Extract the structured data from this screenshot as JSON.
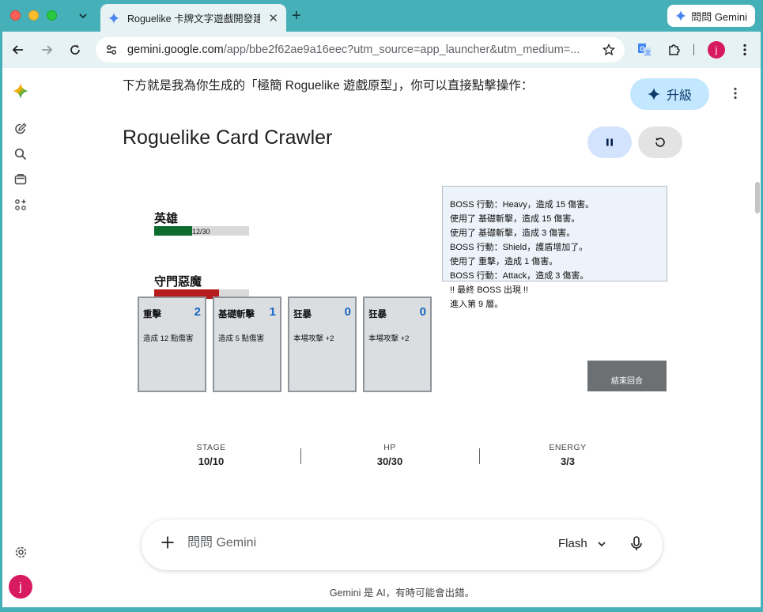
{
  "browser": {
    "tab_title": "Roguelike 卡牌文字遊戲開發建",
    "ask_gemini": "問問 Gemini",
    "url_host": "gemini.google.com",
    "url_path": "/app/bbe2f62ae9a16eec?utm_source=app_launcher&utm_medium=...",
    "profile_initial": "j"
  },
  "sidebar": {
    "avatar_initial": "j"
  },
  "header": {
    "upgrade_label": "升級"
  },
  "chat": {
    "intro": "下方就是我為你生成的「極簡 Roguelike 遊戲原型」，你可以直接點擊操作："
  },
  "game": {
    "title": "Roguelike Card Crawler",
    "hero": {
      "name": "英雄",
      "hp_text": "12/30",
      "hp_fraction": 0.4
    },
    "boss": {
      "name": "守門惡魔",
      "hp_fraction": 0.68
    },
    "cards": [
      {
        "name": "重擊",
        "cost": "2",
        "desc": "造成 12 點傷害"
      },
      {
        "name": "基礎斬擊",
        "cost": "1",
        "desc": "造成 5 點傷害"
      },
      {
        "name": "狂暴",
        "cost": "0",
        "desc": "本場攻擊 +2"
      },
      {
        "name": "狂暴",
        "cost": "0",
        "desc": "本場攻擊 +2"
      }
    ],
    "log": [
      "BOSS 行動：Heavy，造成 15 傷害。",
      "使用了 基礎斬擊，造成 15 傷害。",
      "使用了 基礎斬擊，造成 3 傷害。",
      "BOSS 行動：Shield，護盾增加了。",
      "使用了 重擊，造成 1 傷害。",
      "BOSS 行動：Attack，造成 3 傷害。",
      "!! 最終 BOSS 出現 !!",
      "進入第 9 層。"
    ],
    "end_turn_label": "結束回合"
  },
  "stats": [
    {
      "label": "STAGE",
      "value": "10/10"
    },
    {
      "label": "HP",
      "value": "30/30"
    },
    {
      "label": "ENERGY",
      "value": "3/3"
    }
  ],
  "prompt": {
    "placeholder": "問問 Gemini",
    "model": "Flash"
  },
  "footer": {
    "disclaimer": "Gemini 是 AI，有時可能會出錯。"
  },
  "colors": {
    "chrome": "#46b0b8",
    "hero_hp": "#0f6b2e",
    "boss_hp": "#b71c1c",
    "card_cost": "#1565c0",
    "end_turn": "#6d7073"
  }
}
